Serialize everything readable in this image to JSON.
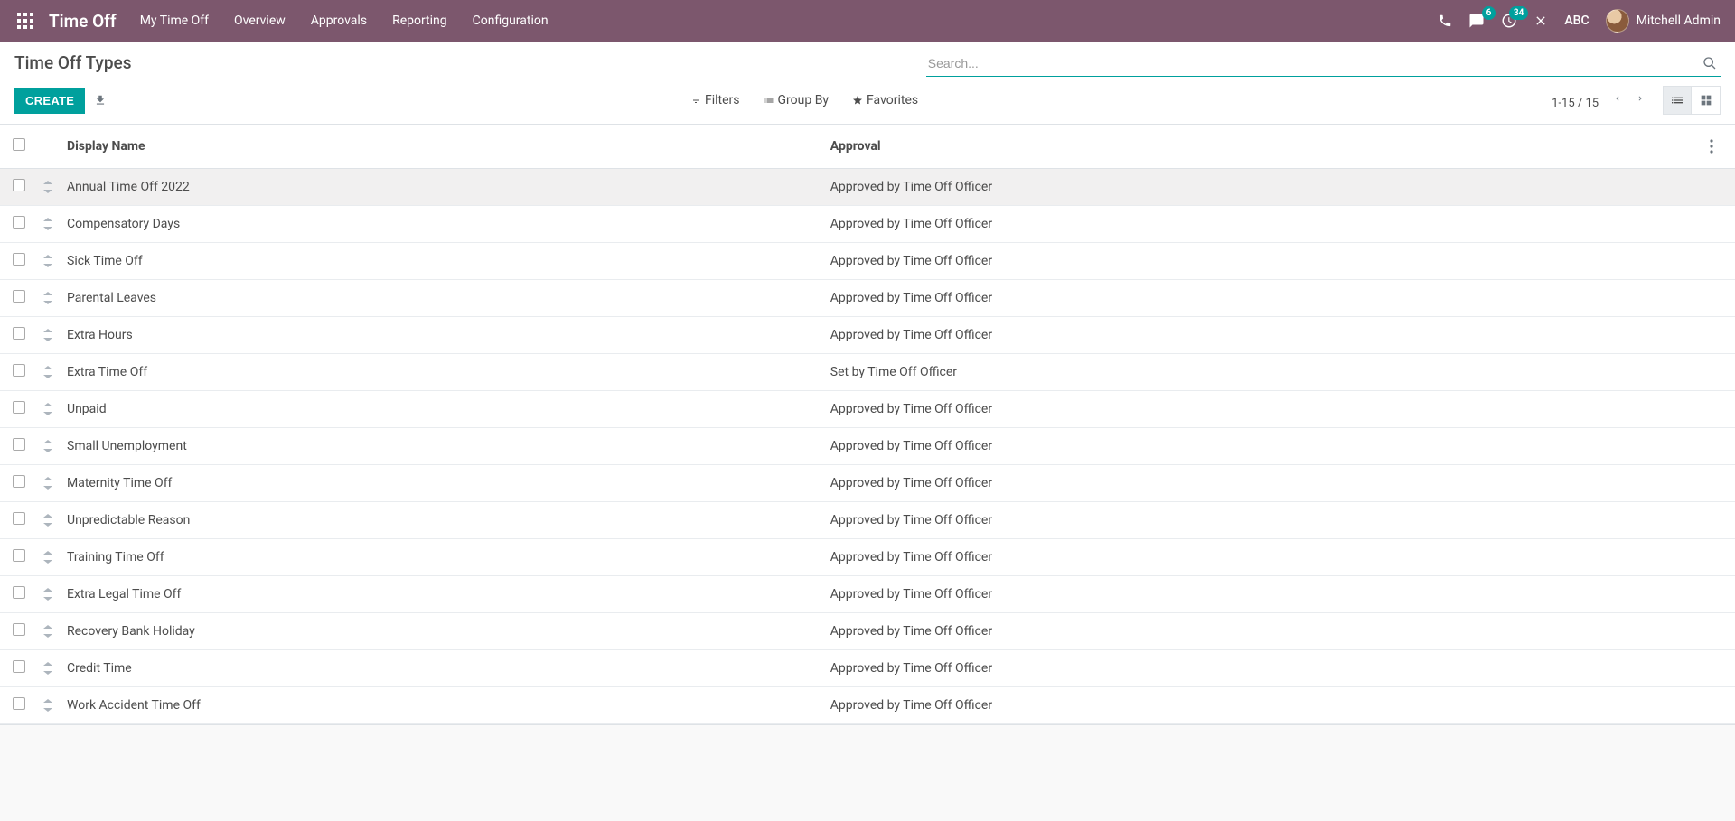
{
  "navbar": {
    "brand": "Time Off",
    "items": [
      "My Time Off",
      "Overview",
      "Approvals",
      "Reporting",
      "Configuration"
    ],
    "msg_badge": "6",
    "activity_badge": "34",
    "company_abbr": "ABC",
    "user_name": "Mitchell Admin"
  },
  "control_panel": {
    "title": "Time Off Types",
    "search_placeholder": "Search...",
    "create_label": "CREATE",
    "filters_label": "Filters",
    "groupby_label": "Group By",
    "favorites_label": "Favorites",
    "pager_text": "1-15 / 15"
  },
  "table": {
    "headers": {
      "display_name": "Display Name",
      "approval": "Approval"
    },
    "rows": [
      {
        "name": "Annual Time Off 2022",
        "approval": "Approved by Time Off Officer"
      },
      {
        "name": "Compensatory Days",
        "approval": "Approved by Time Off Officer"
      },
      {
        "name": "Sick Time Off",
        "approval": "Approved by Time Off Officer"
      },
      {
        "name": "Parental Leaves",
        "approval": "Approved by Time Off Officer"
      },
      {
        "name": "Extra Hours",
        "approval": "Approved by Time Off Officer"
      },
      {
        "name": "Extra Time Off",
        "approval": "Set by Time Off Officer"
      },
      {
        "name": "Unpaid",
        "approval": "Approved by Time Off Officer"
      },
      {
        "name": "Small Unemployment",
        "approval": "Approved by Time Off Officer"
      },
      {
        "name": "Maternity Time Off",
        "approval": "Approved by Time Off Officer"
      },
      {
        "name": "Unpredictable Reason",
        "approval": "Approved by Time Off Officer"
      },
      {
        "name": "Training Time Off",
        "approval": "Approved by Time Off Officer"
      },
      {
        "name": "Extra Legal Time Off",
        "approval": "Approved by Time Off Officer"
      },
      {
        "name": "Recovery Bank Holiday",
        "approval": "Approved by Time Off Officer"
      },
      {
        "name": "Credit Time",
        "approval": "Approved by Time Off Officer"
      },
      {
        "name": "Work Accident Time Off",
        "approval": "Approved by Time Off Officer"
      }
    ]
  }
}
